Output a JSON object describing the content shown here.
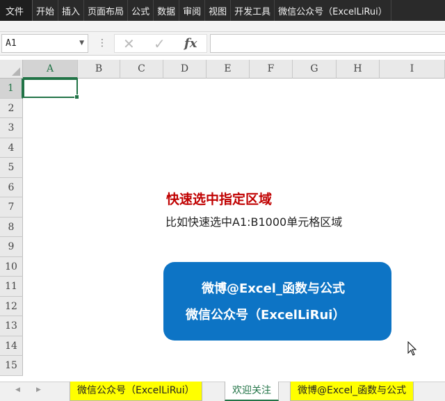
{
  "ribbon": {
    "file_tab": "文件",
    "tabs": [
      "开始",
      "插入",
      "页面布局",
      "公式",
      "数据",
      "审阅",
      "视图",
      "开发工具",
      "微信公众号（ExcelLiRui）"
    ]
  },
  "formula_bar": {
    "name_box": "A1",
    "formula": ""
  },
  "grid": {
    "columns": [
      "A",
      "B",
      "C",
      "D",
      "E",
      "F",
      "G",
      "H",
      "I"
    ],
    "rows": [
      "1",
      "2",
      "3",
      "4",
      "5",
      "6",
      "7",
      "8",
      "9",
      "10",
      "11",
      "12",
      "13",
      "14",
      "15"
    ],
    "selected_cell": "A1"
  },
  "annotation": {
    "title": "快速选中指定区域",
    "body": "比如快速选中A1:B1000单元格区域"
  },
  "badge": {
    "line1": "微博@Excel_函数与公式",
    "line2": "微信公众号（ExcelLiRui）"
  },
  "sheet_tabs": {
    "tabs": [
      "微信公众号（ExcelLiRui）",
      "欢迎关注",
      "微博@Excel_函数与公式"
    ],
    "active": "欢迎关注"
  },
  "colors": {
    "accent": "#217346",
    "title_red": "#c00000",
    "badge_blue": "#0d74c5",
    "tab_yellow": "#ffff00"
  }
}
